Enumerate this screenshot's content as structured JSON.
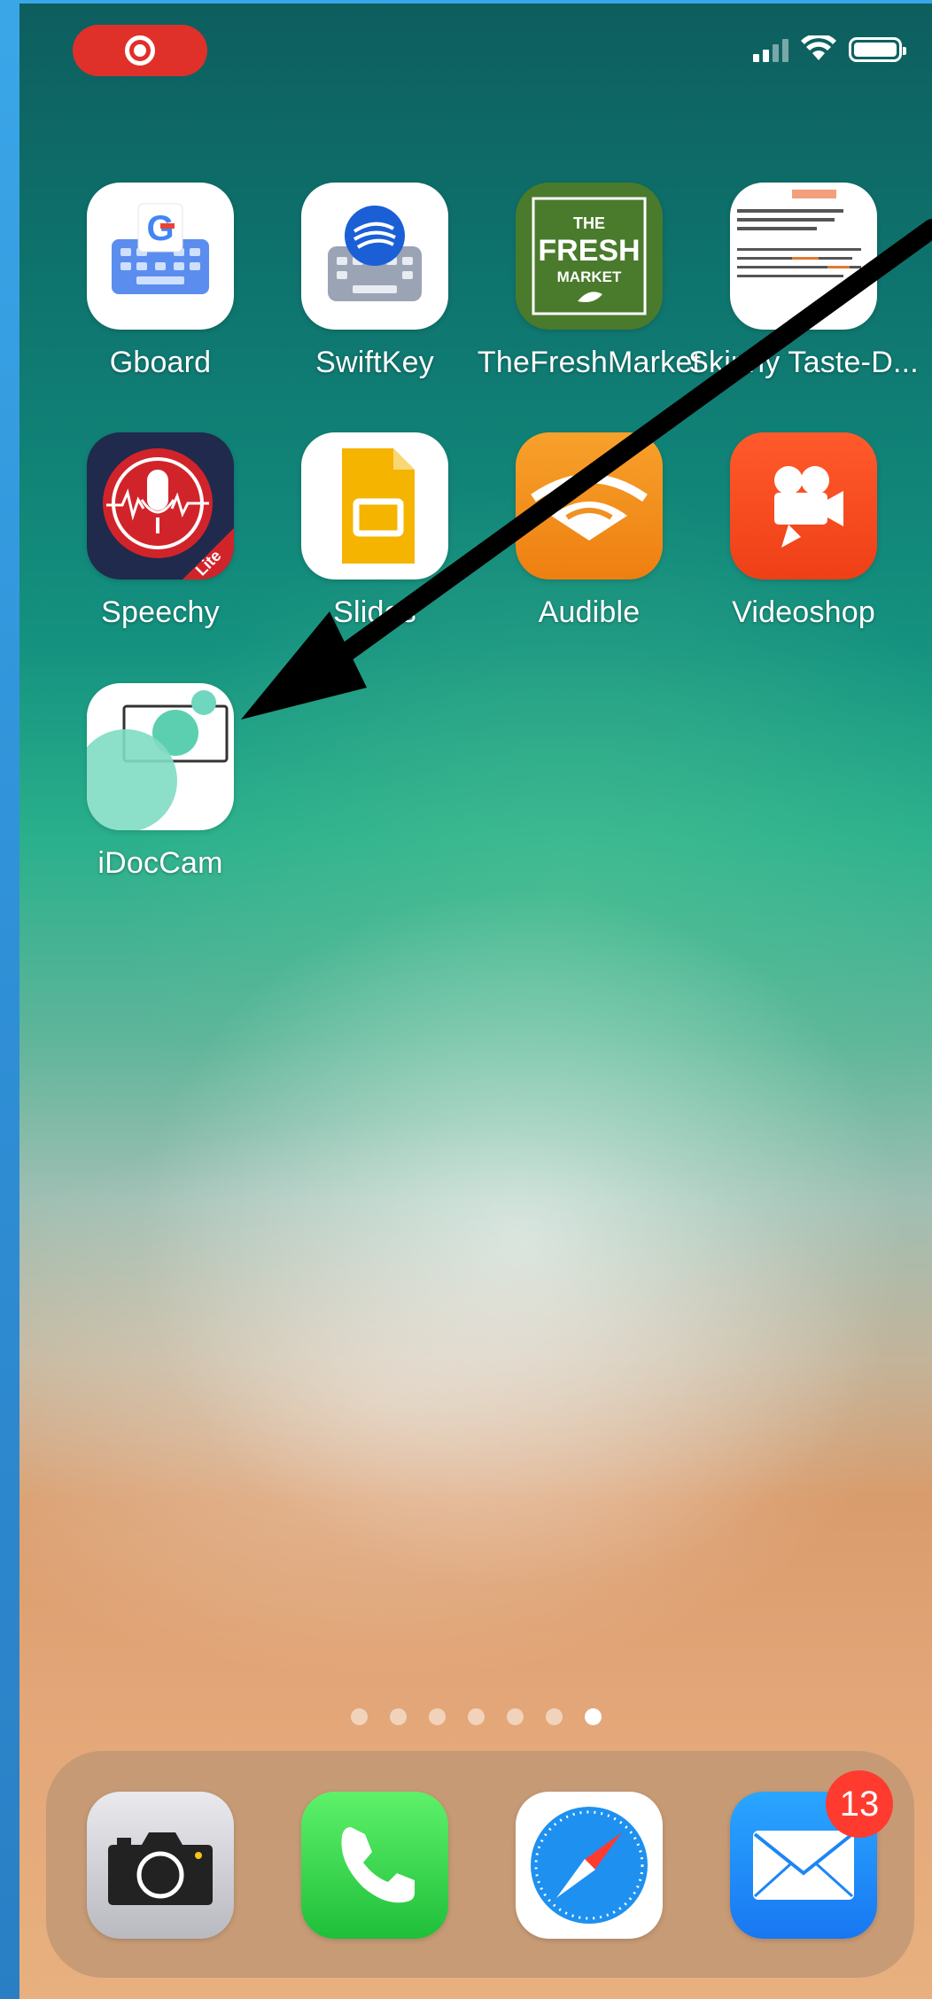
{
  "status_bar": {
    "recording_indicator": "screen-recording",
    "signal_bars_active": 2,
    "signal_bars_total": 4,
    "wifi": "wifi-icon",
    "battery_level": 0.95
  },
  "apps": [
    {
      "label": "Gboard",
      "icon": "gboard-icon"
    },
    {
      "label": "SwiftKey",
      "icon": "swiftkey-icon"
    },
    {
      "label": "TheFreshMarket",
      "icon": "fresh-market-icon",
      "icon_text": [
        "THE",
        "FRESH",
        "MARKET"
      ]
    },
    {
      "label": "Skinny Taste-D...",
      "icon": "skinny-taste-icon"
    },
    {
      "label": "Speechy",
      "icon": "speechy-icon",
      "icon_text": "Lite"
    },
    {
      "label": "Slides",
      "icon": "slides-icon"
    },
    {
      "label": "Audible",
      "icon": "audible-icon"
    },
    {
      "label": "Videoshop",
      "icon": "videoshop-icon"
    },
    {
      "label": "iDocCam",
      "icon": "idoccam-icon"
    }
  ],
  "page_indicator": {
    "total": 7,
    "active": 7
  },
  "dock": [
    {
      "name": "Camera",
      "icon": "camera-icon"
    },
    {
      "name": "Phone",
      "icon": "phone-icon"
    },
    {
      "name": "Safari",
      "icon": "safari-icon"
    },
    {
      "name": "Mail",
      "icon": "mail-icon",
      "badge": "13"
    }
  ],
  "annotation": {
    "type": "arrow",
    "points_to": "iDocCam"
  },
  "colors": {
    "accent_red": "#e0302a",
    "badge_red": "#ff3b30",
    "frame_blue": "#3aa6e8"
  }
}
